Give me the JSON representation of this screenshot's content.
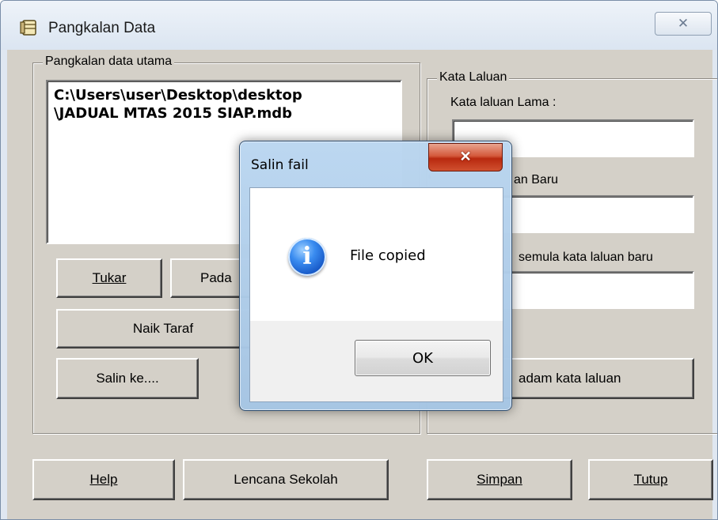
{
  "window": {
    "title": "Pangkalan Data",
    "close_glyph": "✕"
  },
  "database_group": {
    "legend": "Pangkalan data utama",
    "path_line1": "C:\\Users\\user\\Desktop\\desktop",
    "path_line2": "\\JADUAL MTAS 2015 SIAP.mdb"
  },
  "buttons": {
    "tukar": "Tukar",
    "padam_visible": "Pada",
    "naik_taraf": "Naik Taraf",
    "salin_ke": "Salin ke....",
    "padam_kata_laluan_visible": "adam kata laluan",
    "help": "Help",
    "lencana_sekolah": "Lencana Sekolah",
    "simpan": "Simpan",
    "tutup": "Tutup"
  },
  "password_group": {
    "legend": "Kata Laluan",
    "old_label": "Kata laluan Lama   :",
    "new_label_visible": "an Baru",
    "confirm_label_visible": "semula kata laluan baru",
    "old_value": "",
    "new_value": "",
    "confirm_value": ""
  },
  "dialog": {
    "title": "Salin fail",
    "close_glyph": "✕",
    "message": "File copied",
    "ok_label": "OK",
    "icon": "info-icon"
  },
  "colors": {
    "face": "#d4d0c8",
    "dialog_frame": "#a5c5e4",
    "close_red": "#c73a1d"
  }
}
